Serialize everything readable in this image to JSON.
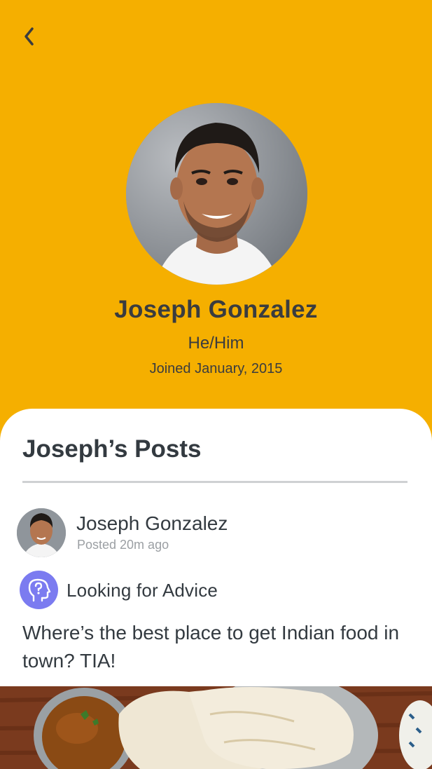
{
  "header": {
    "back_icon": "chevron-left-icon",
    "background_color": "#F5AF00"
  },
  "profile": {
    "name": "Joseph Gonzalez",
    "pronouns": "He/Him",
    "joined": "Joined January, 2015",
    "avatar": "profile-photo"
  },
  "posts_section": {
    "title": "Joseph’s Posts"
  },
  "post": {
    "author": "Joseph Gonzalez",
    "time": "Posted 20m ago",
    "category": "Looking for Advice",
    "category_icon": "advice-head-icon",
    "category_color": "#7B7BF0",
    "body": "Where’s the best place to get Indian food in town? TIA!",
    "image": "indian-food-photo"
  }
}
